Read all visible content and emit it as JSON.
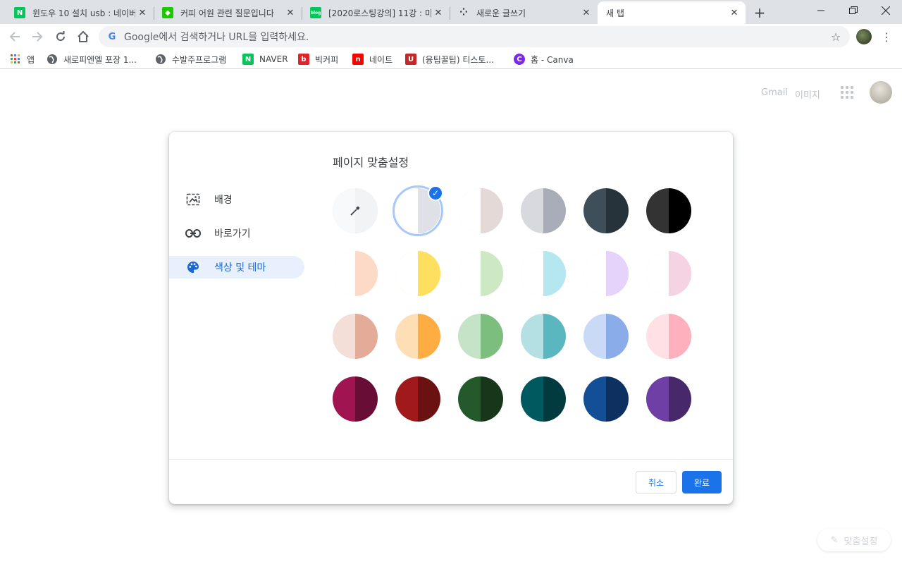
{
  "tabs": [
    {
      "title": "윈도우 10 설치 usb : 네이버",
      "favicon": "naver-icon",
      "favicon_letter": "N",
      "favicon_color": "#03c75a"
    },
    {
      "title": "커피 어원 관련 질문입니다",
      "favicon": "kin-icon",
      "favicon_letter": "◆",
      "favicon_color": "#1ec800"
    },
    {
      "title": "[2020로스팅강의] 11강 : 미",
      "favicon": "blog-icon",
      "favicon_letter": "blog",
      "favicon_color": "#03c75a"
    },
    {
      "title": "새로운 글쓰기",
      "favicon": "tistory-icon",
      "favicon_letter": "⁘",
      "favicon_color": "#ffffff"
    },
    {
      "title": "새 탭",
      "active": true
    }
  ],
  "toolbar": {
    "omnibox_placeholder": "Google에서 검색하거나 URL을 입력하세요.",
    "g_letter": "G"
  },
  "bookmarks": [
    {
      "label": "앱",
      "icon": "apps-icon"
    },
    {
      "label": "새로피엔엘 포장 1...",
      "icon": "globe-icon"
    },
    {
      "label": "수발주프로그램",
      "icon": "globe-icon"
    },
    {
      "label": "NAVER",
      "icon": "naver-icon",
      "letter": "N",
      "color": "#03c75a"
    },
    {
      "label": "빅커피",
      "icon": "bigcoffee-icon",
      "letter": "b",
      "color": "#e0242b"
    },
    {
      "label": "네이트",
      "icon": "nate-icon",
      "letter": "n",
      "color": "#ff0000"
    },
    {
      "label": "(융팁꿀팁) 티스토...",
      "icon": "tistory-u-icon",
      "letter": "U",
      "color": "#c62828"
    },
    {
      "label": "홈 - Canva",
      "icon": "canva-icon",
      "letter": "C",
      "color": "#7d2ae8"
    }
  ],
  "ntp": {
    "gmail": "Gmail",
    "images": "이미지"
  },
  "dialog": {
    "title": "페이지 맞춤설정",
    "menu": [
      {
        "label": "배경",
        "icon": "background-image-icon"
      },
      {
        "label": "바로가기",
        "icon": "link-icon"
      },
      {
        "label": "색상 및 테마",
        "icon": "palette-icon",
        "selected": true
      }
    ],
    "cancel": "취소",
    "done": "완료",
    "check": "✓",
    "swatches": [
      [
        [
          "#f1f3f4",
          "#f1f3f4",
          "picker"
        ],
        [
          "#ffffff",
          "#dee1e6",
          "selected"
        ],
        [
          "#ffffff",
          "#e3dad8"
        ],
        [
          "#d8d9df",
          "#a9adb9"
        ],
        [
          "#3e4f5a",
          "#27333a"
        ],
        [
          "#333333",
          "#000000"
        ]
      ],
      [
        [
          "#ffffff",
          "#fddac7"
        ],
        [
          "#ffffff",
          "#fedf60"
        ],
        [
          "#ffffff",
          "#cde9c4"
        ],
        [
          "#ffffff",
          "#b4e7f0"
        ],
        [
          "#ffffff",
          "#e6d3fb"
        ],
        [
          "#ffffff",
          "#f6d3e2"
        ]
      ],
      [
        [
          "#f3ded8",
          "#e4ab99"
        ],
        [
          "#fedeb4",
          "#fdad41"
        ],
        [
          "#c5e4c7",
          "#7cbe7e"
        ],
        [
          "#b4dfe3",
          "#5bb7bf"
        ],
        [
          "#c8daf5",
          "#8aadea"
        ],
        [
          "#fee0e5",
          "#feb0bd"
        ]
      ],
      [
        [
          "#a11452",
          "#680d35"
        ],
        [
          "#a11a1b",
          "#6a1111"
        ],
        [
          "#245a2b",
          "#17371b"
        ],
        [
          "#015960",
          "#013b3f"
        ],
        [
          "#134f96",
          "#0c3160"
        ],
        [
          "#6f3fa5",
          "#47286a"
        ]
      ]
    ]
  },
  "customize": {
    "label": "맞춤설정"
  }
}
